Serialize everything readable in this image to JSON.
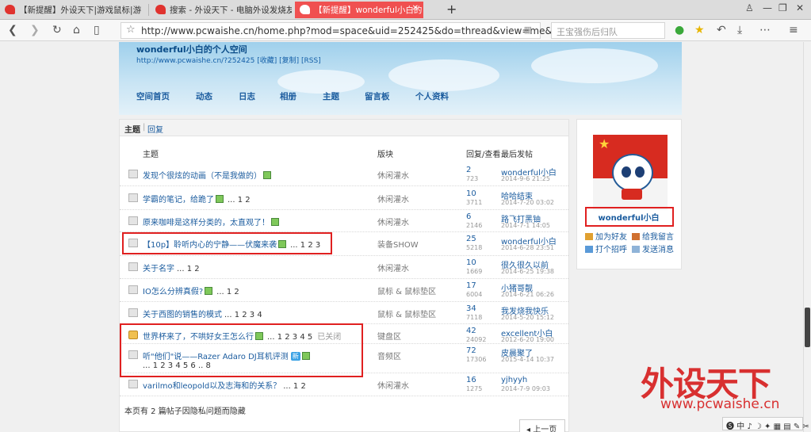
{
  "browser": {
    "tabs": [
      {
        "label": "【新提醒】外设天下|游戏鼠标|游"
      },
      {
        "label": "搜索 - 外设天下 - 电脑外设发烧友"
      },
      {
        "label": "【新提醒】wonderful小白的"
      }
    ],
    "new_tab": "+",
    "window_controls": [
      "♙",
      "—",
      "❐",
      "✕"
    ],
    "url": "http://www.pcwaishe.cn/home.php?mod=space&uid=252425&do=thread&view=me&order",
    "search_placeholder": "王宝强伤后归队"
  },
  "space": {
    "name": "wonderful小白的个人空间",
    "url_line": "http://www.pcwaishe.cn/?252425 [收藏] [复制] [RSS]",
    "nav": [
      "空间首页",
      "动态",
      "日志",
      "相册",
      "主题",
      "留言板",
      "个人资料"
    ]
  },
  "subtabs": {
    "active": "主题",
    "other": "回复",
    "sep": "|"
  },
  "table": {
    "headers": {
      "title": "主题",
      "forum": "版块",
      "stats": "回复/查看",
      "last": "最后发帖"
    },
    "rows": [
      {
        "title": "发现个很炫的动画（不是我做的）",
        "pages": "",
        "closed": "",
        "forum": "休闲灌水",
        "replies": "2",
        "views": "723",
        "user": "wonderful小白",
        "date": "2014-9-6 21:25",
        "lock": false,
        "img": true,
        "new": false
      },
      {
        "title": "学霸的笔记，给跪了",
        "pages": "... 1 2",
        "closed": "",
        "forum": "休闲灌水",
        "replies": "10",
        "views": "3711",
        "user": "哈哈结束",
        "date": "2014-7-20 03:02",
        "lock": false,
        "img": true,
        "new": false
      },
      {
        "title": "原来咖啡是这样分类的，太直观了！",
        "pages": "",
        "closed": "",
        "forum": "休闲灌水",
        "replies": "6",
        "views": "2146",
        "user": "路飞打黑铀",
        "date": "2014-7-1 14:05",
        "lock": false,
        "img": true,
        "new": false
      },
      {
        "title": "【10p】聆听内心的宁静——伏魔来袭",
        "pages": "... 1 2 3",
        "closed": "",
        "forum": "装备SHOW",
        "replies": "25",
        "views": "5218",
        "user": "wonderful小白",
        "date": "2014-6-28 23:51",
        "lock": false,
        "img": true,
        "new": false
      },
      {
        "title": "关于名字",
        "pages": "... 1 2",
        "closed": "",
        "forum": "休闲灌水",
        "replies": "10",
        "views": "1669",
        "user": "很久很久以前",
        "date": "2014-6-25 19:38",
        "lock": false,
        "img": false,
        "new": false
      },
      {
        "title": "IO怎么分辨真假?",
        "pages": "... 1 2",
        "closed": "",
        "forum": "鼠标 & 鼠标垫区",
        "replies": "17",
        "views": "6004",
        "user": "小猪哥靓",
        "date": "2014-6-21 06:26",
        "lock": false,
        "img": true,
        "new": false
      },
      {
        "title": "关于西图的销售的模式",
        "pages": "... 1 2 3 4",
        "closed": "",
        "forum": "鼠标 & 鼠标垫区",
        "replies": "34",
        "views": "7118",
        "user": "我发烧我快乐",
        "date": "2014-5-20 15:12",
        "lock": false,
        "img": false,
        "new": false
      },
      {
        "title": "世界杯来了，不哄好女王怎么行",
        "pages": "... 1 2 3 4 5",
        "closed": "已关闭",
        "forum": "键盘区",
        "replies": "42",
        "views": "24092",
        "user": "excellent小白",
        "date": "2012-6-20 19:00",
        "lock": true,
        "img": true,
        "new": false
      },
      {
        "title": "听\"他们\"说——Razer Adaro DJ耳机评测",
        "pages": "... 1 2 3 4 5 6 .. 8",
        "closed": "",
        "forum": "音频区",
        "replies": "72",
        "views": "17306",
        "user": "皮晨聚了",
        "date": "2015-4-14 10:37",
        "lock": false,
        "img": true,
        "new": true
      },
      {
        "title": "varilmo和leopold以及志海和的关系？",
        "pages": "... 1 2",
        "closed": "",
        "forum": "休闲灌水",
        "replies": "16",
        "views": "1275",
        "user": "yjhyyh",
        "date": "2014-7-9 09:03",
        "lock": false,
        "img": false,
        "new": false
      }
    ],
    "new_badge": "新",
    "footnote": "本页有 2 篇帖子因隐私问题而隐藏",
    "prev": "◂ 上一页"
  },
  "profile": {
    "name": "wonderful小白",
    "actions": [
      "加为好友",
      "给我留言",
      "打个招呼",
      "发送消息"
    ]
  },
  "watermark": {
    "brand": "外设天下",
    "url": "www.pcwaishe.cn"
  },
  "status_bar": "🅢 中 ♪ ☽ ✦ ▦ ▤ ✎ ✂",
  "colors": {
    "tab_active": "#f05050",
    "link": "#1a5b9e",
    "highlight": "#e02020"
  }
}
